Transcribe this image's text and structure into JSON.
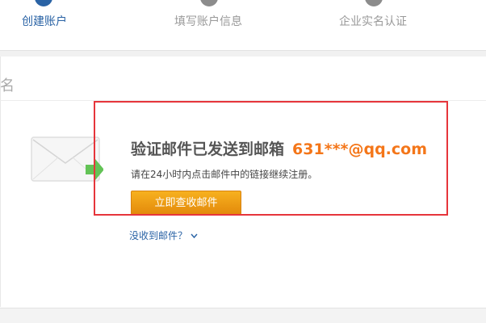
{
  "steps": [
    {
      "label": "创建账户",
      "state": "active"
    },
    {
      "label": "填写账户信息",
      "state": "inactive"
    },
    {
      "label": "企业实名认证",
      "state": "inactive"
    }
  ],
  "section": {
    "title": "名"
  },
  "verify": {
    "headline": "验证邮件已发送到邮箱",
    "email": "631***@qq.com",
    "instruction": "请在24小时内点击邮件中的链接继续注册。",
    "check_button": "立即查收邮件",
    "not_received_link": "没收到邮件？"
  },
  "colors": {
    "accent": "#2a63a5",
    "email": "#f47619",
    "button": "#f29d12",
    "highlight_box": "#e6353b"
  },
  "icons": {
    "envelope": "envelope-icon",
    "arrow": "arrow-right-icon",
    "chevron": "chevron-down-icon"
  }
}
